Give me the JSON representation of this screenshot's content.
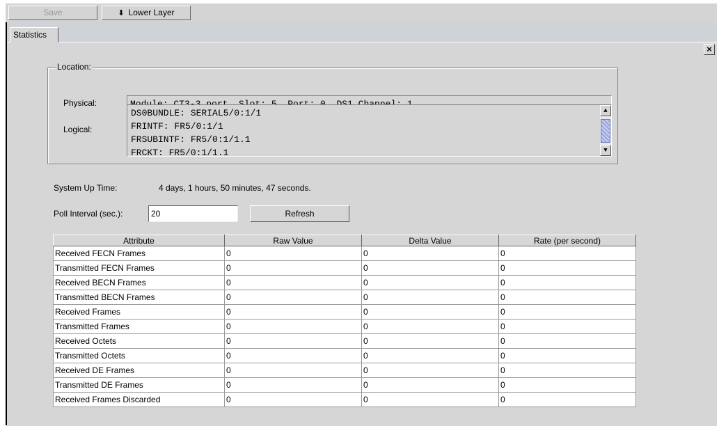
{
  "toolbar": {
    "save_label": "Save",
    "lower_layer_label": "Lower Layer"
  },
  "tab": {
    "label": "Statistics"
  },
  "location": {
    "legend": "Location:",
    "physical_label": "Physical:",
    "physical_value": "Module: CT3-3 port, Slot: 5, Port: 0, DS1 Channel: 1",
    "logical_label": "Logical:",
    "logical_lines": [
      "DS0BUNDLE: SERIAL5/0:1/1",
      "FRINTF: FR5/0:1/1",
      "FRSUBINTF: FR5/0:1/1.1",
      "FRCKT: FR5/0:1/1.1"
    ]
  },
  "uptime": {
    "label": "System Up Time:",
    "value": "4 days, 1 hours, 50 minutes, 47 seconds."
  },
  "poll": {
    "label": "Poll Interval (sec.):",
    "value": "20",
    "refresh_label": "Refresh"
  },
  "table": {
    "headers": [
      "Attribute",
      "Raw Value",
      "Delta Value",
      "Rate (per second)"
    ],
    "rows": [
      [
        "Received FECN Frames",
        "0",
        "0",
        "0"
      ],
      [
        "Transmitted FECN Frames",
        "0",
        "0",
        "0"
      ],
      [
        "Received BECN Frames",
        "0",
        "0",
        "0"
      ],
      [
        "Transmitted BECN Frames",
        "0",
        "0",
        "0"
      ],
      [
        "Received Frames",
        "0",
        "0",
        "0"
      ],
      [
        "Transmitted Frames",
        "0",
        "0",
        "0"
      ],
      [
        "Received Octets",
        "0",
        "0",
        "0"
      ],
      [
        "Transmitted Octets",
        "0",
        "0",
        "0"
      ],
      [
        "Received DE Frames",
        "0",
        "0",
        "0"
      ],
      [
        "Transmitted DE Frames",
        "0",
        "0",
        "0"
      ],
      [
        "Received Frames Discarded",
        "0",
        "0",
        "0"
      ]
    ]
  }
}
